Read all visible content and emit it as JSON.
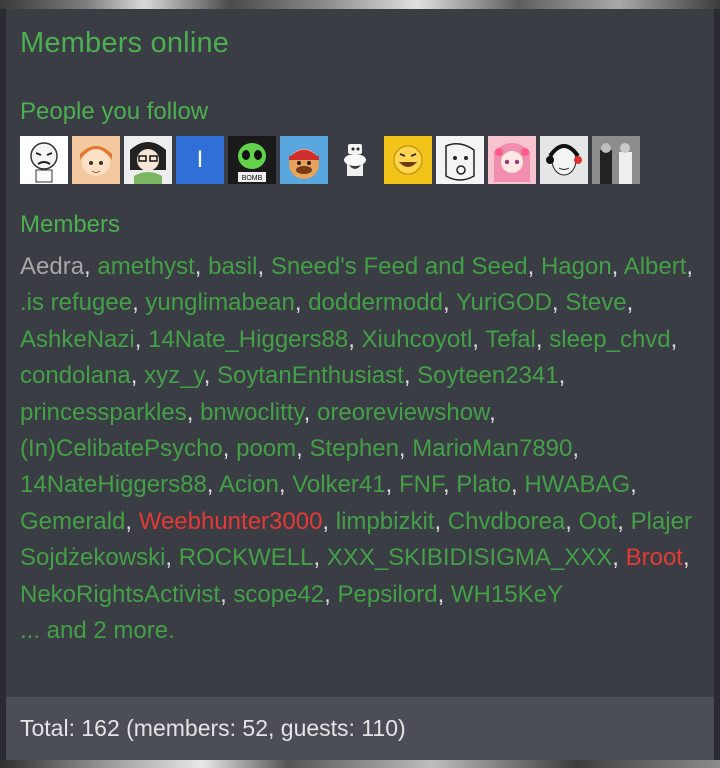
{
  "widget": {
    "title": "Members online",
    "follow_heading": "People you follow",
    "members_heading": "Members"
  },
  "follow_avatars": [
    {
      "icon": "crying-meme-face-avatar",
      "bg": "#ffffff"
    },
    {
      "icon": "anime-girl-avatar",
      "bg": "#f4c9a0"
    },
    {
      "icon": "glasses-girl-avatar",
      "bg": "#eeeeee"
    },
    {
      "letter": "I",
      "icon": "letter-avatar",
      "bg": "#2f6fd6"
    },
    {
      "icon": "alien-skull-avatar",
      "bg": "#1a1a1a"
    },
    {
      "icon": "red-cap-face-avatar",
      "bg": "#5aa7e0"
    },
    {
      "icon": "toilet-avatar",
      "bg": "#3a3d44"
    },
    {
      "icon": "yellow-face-avatar",
      "bg": "#f2c21a"
    },
    {
      "icon": "sketch-face-avatar",
      "bg": "#f4f4f4"
    },
    {
      "icon": "pink-anime-avatar",
      "bg": "#f6c3cf"
    },
    {
      "icon": "headset-wojak-avatar",
      "bg": "#e6e6e6"
    },
    {
      "icon": "old-photo-avatar",
      "bg": "#9a9a9a"
    }
  ],
  "members": [
    {
      "name": "Aedra",
      "role": "self"
    },
    {
      "name": "amethyst",
      "role": "member"
    },
    {
      "name": "basil",
      "role": "member"
    },
    {
      "name": "Sneed's Feed and Seed",
      "role": "member"
    },
    {
      "name": "Hagon",
      "role": "member"
    },
    {
      "name": "Albert",
      "role": "member"
    },
    {
      "name": ".is refugee",
      "role": "member"
    },
    {
      "name": "yunglimabean",
      "role": "member"
    },
    {
      "name": "doddermodd",
      "role": "member"
    },
    {
      "name": "YuriGOD",
      "role": "member"
    },
    {
      "name": "Steve",
      "role": "member"
    },
    {
      "name": "AshkeNazi",
      "role": "member"
    },
    {
      "name": "14Nate_Higgers88",
      "role": "member"
    },
    {
      "name": "Xiuhcoyotl",
      "role": "member"
    },
    {
      "name": "Tefal",
      "role": "member"
    },
    {
      "name": "sleep_chvd",
      "role": "member"
    },
    {
      "name": "condolana",
      "role": "member"
    },
    {
      "name": "xyz_y",
      "role": "member"
    },
    {
      "name": "SoytanEnthusiast",
      "role": "member"
    },
    {
      "name": "Soyteen2341",
      "role": "member"
    },
    {
      "name": "princessparkles",
      "role": "member"
    },
    {
      "name": "bnwoclitty",
      "role": "member"
    },
    {
      "name": "oreoreviewshow",
      "role": "member"
    },
    {
      "name": "(In)CelibatePsycho",
      "role": "member"
    },
    {
      "name": "poom",
      "role": "member"
    },
    {
      "name": "Stephen",
      "role": "member"
    },
    {
      "name": "MarioMan7890",
      "role": "member"
    },
    {
      "name": "14NateHiggers88",
      "role": "member"
    },
    {
      "name": "Acion",
      "role": "member"
    },
    {
      "name": "Volker41",
      "role": "member"
    },
    {
      "name": "FNF",
      "role": "member"
    },
    {
      "name": "Plato",
      "role": "member"
    },
    {
      "name": "HWABAG",
      "role": "member"
    },
    {
      "name": "Gemerald",
      "role": "member"
    },
    {
      "name": "Weebhunter3000",
      "role": "staff"
    },
    {
      "name": "limpbizkit",
      "role": "member"
    },
    {
      "name": "Chvdborea",
      "role": "member"
    },
    {
      "name": "Oot",
      "role": "member"
    },
    {
      "name": "Plajer Sojdżekowski",
      "role": "member"
    },
    {
      "name": "ROCKWELL",
      "role": "member"
    },
    {
      "name": "XXX_SKIBIDISIGMA_XXX",
      "role": "member"
    },
    {
      "name": "Broot",
      "role": "staff"
    },
    {
      "name": "NekoRightsActivist",
      "role": "member"
    },
    {
      "name": "scope42",
      "role": "member"
    },
    {
      "name": "Pepsilord",
      "role": "member"
    },
    {
      "name": "WH15KeY",
      "role": "member"
    }
  ],
  "more_link": "... and 2 more.",
  "footer": {
    "total_text": "Total: 162 (members: 52, guests: 110)"
  },
  "colors": {
    "accent_green": "#43a047",
    "staff_red": "#e53935",
    "panel_bg": "#3a3d44",
    "footer_bg": "#4b4e56"
  }
}
